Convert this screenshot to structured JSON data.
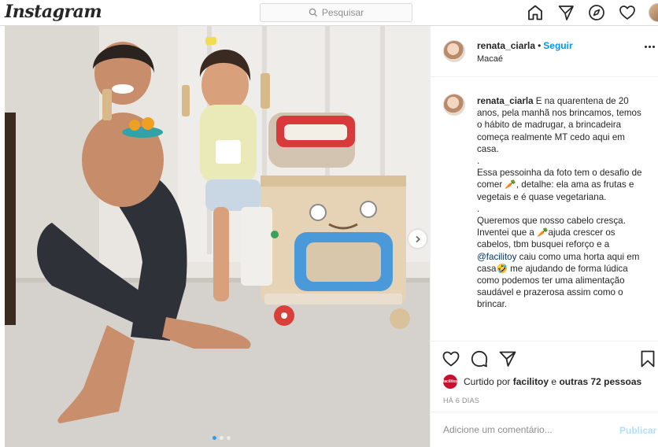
{
  "app": {
    "logo_text": "Instagram"
  },
  "search": {
    "placeholder": "Pesquisar"
  },
  "nav": {
    "icons": [
      "home-icon",
      "direct-icon",
      "explore-icon",
      "activity-icon",
      "profile-avatar"
    ]
  },
  "post": {
    "username": "renata_ciarla",
    "separator": "•",
    "follow_label": "Seguir",
    "location": "Macaé",
    "carousel": {
      "slide_count": 3,
      "active_index": 0
    }
  },
  "caption": {
    "username": "renata_ciarla",
    "paragraphs": [
      "E na quarentena de 20 anos, pela manhã nos brincamos, temos o hábito de madrugar, a brincadeira começa realmente MT cedo aqui em casa.",
      ".",
      "Essa pessoinha da foto tem o desafio de comer 🥕, detalhe: ela ama as frutas e vegetais e é quase vegetariana.",
      ".",
      "Queremos que nosso cabelo cresça. Inventei que a 🥕ajuda crescer os cabelos, tbm busquei reforço e a"
    ],
    "mention": "@facilitoy",
    "tail": " caiu como uma horta aqui em casa🤣 me ajudando de forma lúdica como podemos ter uma alimentação saudável e prazerosa assim como o brincar."
  },
  "likes": {
    "prefix": "Curtido por",
    "liker": "facilitoy",
    "conjunction": "e",
    "others": "outras 72 pessoas",
    "liker_avatar_text": "facilitoy"
  },
  "date_label": "HÁ 6 DIAS",
  "comment": {
    "placeholder": "Adicione um comentário...",
    "publish_label": "Publicar"
  },
  "colors": {
    "link_blue": "#0095f6",
    "publish_disabled": "#b2dffc",
    "border": "#dbdbdb",
    "mention": "#00376b"
  }
}
